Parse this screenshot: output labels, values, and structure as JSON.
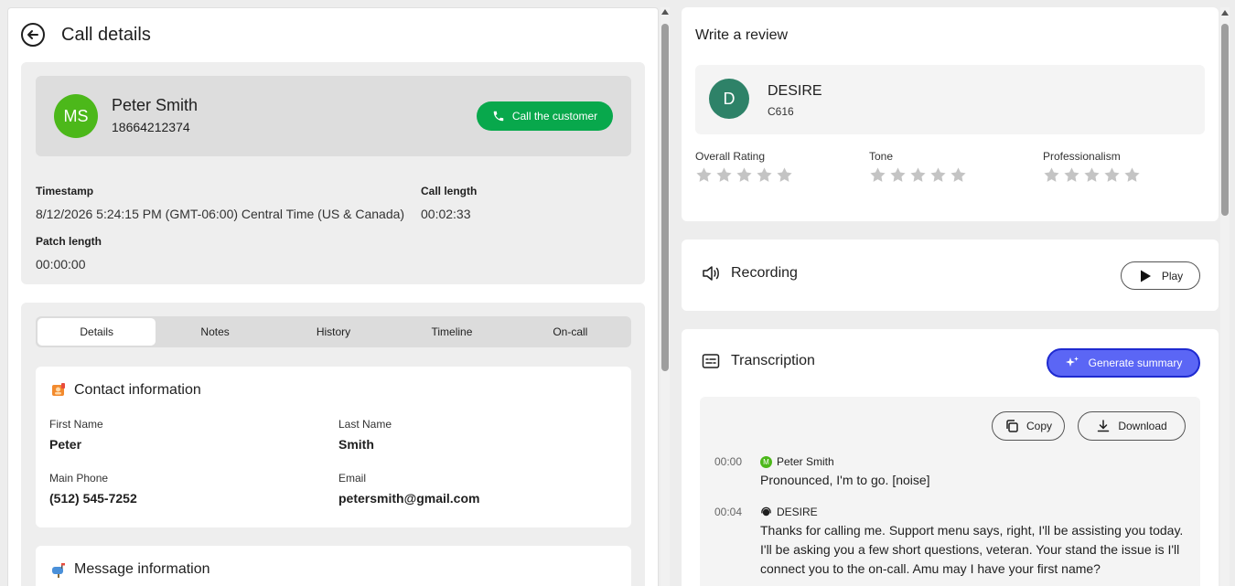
{
  "call": {
    "title": "Call details",
    "customer": {
      "initials": "MS",
      "name": "Peter Smith",
      "phone": "18664212374",
      "call_button": "Call the customer"
    },
    "timestamp_label": "Timestamp",
    "timestamp": "8/12/2026 5:24:15 PM (GMT-06:00) Central Time (US & Canada)",
    "call_length_label": "Call length",
    "call_length": "00:02:33",
    "patch_length_label": "Patch length",
    "patch_length": "00:00:00"
  },
  "tabs": [
    "Details",
    "Notes",
    "History",
    "Timeline",
    "On-call"
  ],
  "contact": {
    "title": "Contact information",
    "first_name_label": "First Name",
    "first_name": "Peter",
    "last_name_label": "Last Name",
    "last_name": "Smith",
    "main_phone_label": "Main Phone",
    "main_phone": "(512) 545-7252",
    "email_label": "Email",
    "email": "petersmith@gmail.com"
  },
  "message": {
    "title": "Message information"
  },
  "review": {
    "title": "Write a review",
    "agent_initial": "D",
    "agent_name": "DESIRE",
    "agent_code": "C616",
    "ratings": [
      {
        "label": "Overall Rating",
        "value": 0,
        "max": 5
      },
      {
        "label": "Tone",
        "value": 0,
        "max": 5
      },
      {
        "label": "Professionalism",
        "value": 0,
        "max": 5
      }
    ]
  },
  "recording": {
    "title": "Recording",
    "play_label": "Play"
  },
  "transcription": {
    "title": "Transcription",
    "generate_label": "Generate summary",
    "copy_label": "Copy",
    "download_label": "Download",
    "entries": [
      {
        "time": "00:00",
        "speaker": "Peter Smith",
        "speaker_initial": "M",
        "text": "Pronounced, I'm to go. [noise]"
      },
      {
        "time": "00:04",
        "speaker": "DESIRE",
        "text": "Thanks for calling me. Support menu says, right, I'll be assisting you today. I'll be asking you a few short questions, veteran. Your stand the issue is I'll connect you to the on-call. Amu may I have your first name?"
      }
    ]
  },
  "colors": {
    "call_button": "#08a84c",
    "customer_avatar": "#4cb81a",
    "agent_avatar": "#2e8268",
    "generate_button": "#5b66f5"
  }
}
